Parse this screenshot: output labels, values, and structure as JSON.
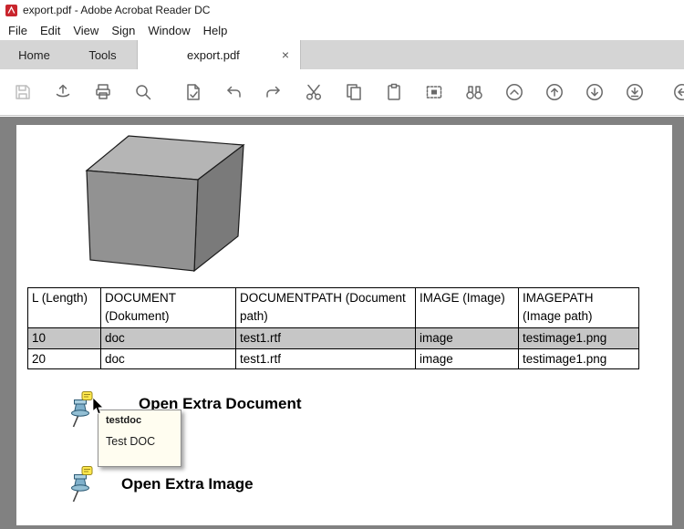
{
  "window": {
    "title": "export.pdf - Adobe Acrobat Reader DC"
  },
  "menu": {
    "items": [
      "File",
      "Edit",
      "View",
      "Sign",
      "Window",
      "Help"
    ]
  },
  "tabs": {
    "home": "Home",
    "tools": "Tools",
    "document": "export.pdf",
    "close_glyph": "×"
  },
  "toolbar": {
    "icons": [
      "save",
      "share",
      "print",
      "zoom",
      "export-pdf",
      "undo",
      "redo",
      "cut",
      "copy",
      "clipboard",
      "snapshot",
      "find-binoculars",
      "collapse",
      "page-up",
      "page-down",
      "last-page",
      "previous-view"
    ]
  },
  "page": {
    "table": {
      "headers": [
        "L (Length)",
        "DOCUMENT (Dokument)",
        "DOCUMENTPATH (Document path)",
        "IMAGE (Image)",
        "IMAGEPATH (Image path)"
      ],
      "rows": [
        [
          "10",
          "doc",
          "test1.rtf",
          "image",
          "testimage1.png"
        ],
        [
          "20",
          "doc",
          "test1.rtf",
          "image",
          "testimage1.png"
        ]
      ]
    },
    "annotations": [
      {
        "label": "Open Extra Document"
      },
      {
        "label": "Open Extra Image"
      }
    ],
    "tooltip": {
      "title": "testdoc",
      "body": "Test DOC"
    }
  },
  "colors": {
    "pane_background": "#818181",
    "row_highlight": "#c6c6c6",
    "tooltip_background": "#fffdf0",
    "pushpin_blue": "#7fb0cb",
    "note_yellow": "#ffe84d",
    "adobe_red": "#c9252d"
  }
}
